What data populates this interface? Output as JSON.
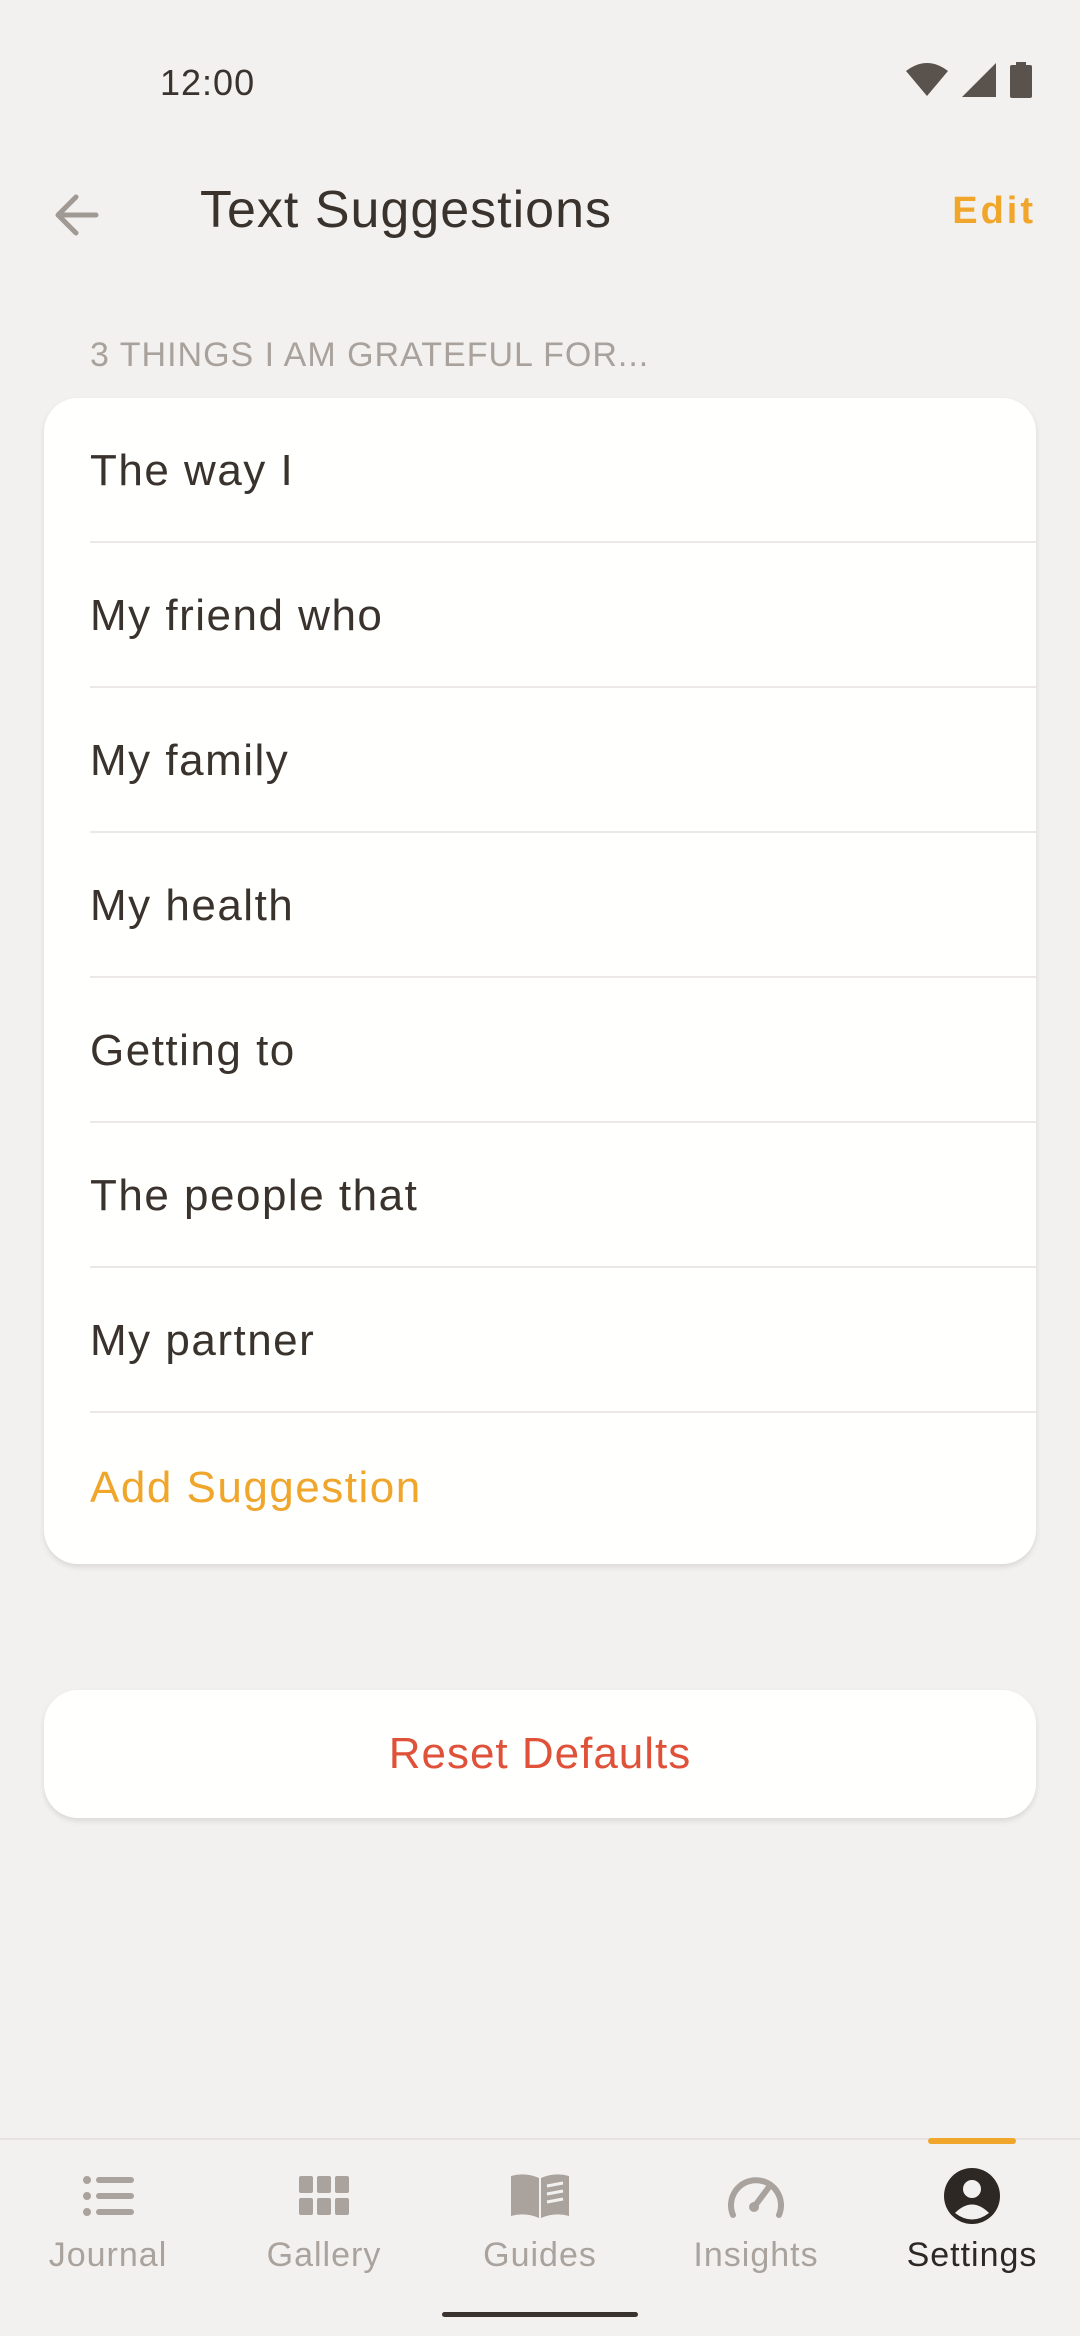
{
  "status": {
    "time": "12:00"
  },
  "header": {
    "title": "Text Suggestions",
    "edit_label": "Edit"
  },
  "section": {
    "label": "3 THINGS I AM GRATEFUL FOR..."
  },
  "suggestions": [
    "The way I",
    "My friend who",
    "My family",
    "My health",
    "Getting to",
    "The people that",
    "My partner"
  ],
  "add_label": "Add Suggestion",
  "reset_label": "Reset Defaults",
  "nav": {
    "items": [
      {
        "label": "Journal",
        "icon": "list-icon"
      },
      {
        "label": "Gallery",
        "icon": "grid-icon"
      },
      {
        "label": "Guides",
        "icon": "book-icon"
      },
      {
        "label": "Insights",
        "icon": "gauge-icon"
      },
      {
        "label": "Settings",
        "icon": "account-icon"
      }
    ],
    "active": "Settings"
  },
  "colors": {
    "accent": "#f0a52b",
    "danger": "#e0513a",
    "background": "#f3f1ef",
    "card": "#fffffd"
  }
}
